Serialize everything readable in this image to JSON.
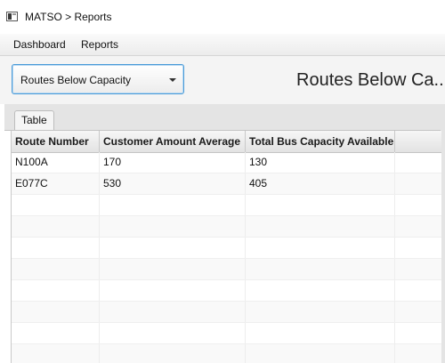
{
  "window": {
    "title": "MATSO > Reports",
    "icon": "app-window-icon"
  },
  "menu": {
    "items": [
      {
        "label": "Dashboard"
      },
      {
        "label": "Reports"
      }
    ]
  },
  "toolbar": {
    "report_select": {
      "selected": "Routes Below Capacity",
      "icon": "chevron-down-icon"
    },
    "report_title": "Routes Below Ca..."
  },
  "tabs": [
    {
      "label": "Table",
      "selected": true
    }
  ],
  "table": {
    "columns": [
      "Route Number",
      "Customer Amount Average",
      "Total Bus Capacity Available"
    ],
    "rows": [
      [
        "N100A",
        "170",
        "130"
      ],
      [
        "E077C",
        "530",
        "405"
      ]
    ]
  },
  "colors": {
    "focus_border": "#4a9bd8",
    "header_bg": "#e3e3e3",
    "tab_area_bg": "#e4e4e4"
  }
}
